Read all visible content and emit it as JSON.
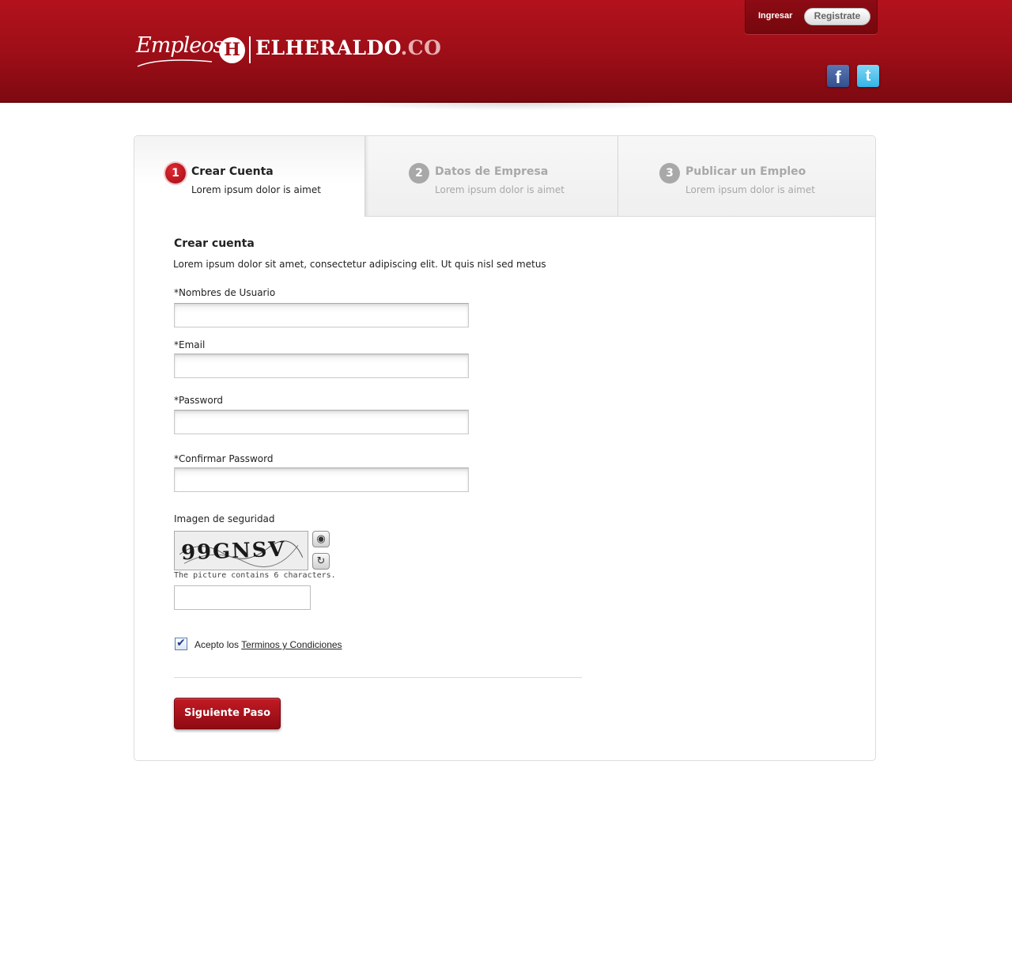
{
  "header": {
    "logo": {
      "script": "Empleos",
      "h_mark": "H",
      "wordmark": "ELHERALDO",
      "tld": ".CO"
    },
    "account": {
      "login_label": "Ingresar",
      "register_label": "Registrate"
    },
    "social": [
      {
        "name": "facebook",
        "glyph": "f"
      },
      {
        "name": "twitter",
        "glyph": "t"
      }
    ]
  },
  "steps": [
    {
      "number": "1",
      "title": "Crear Cuenta",
      "description": "Lorem ipsum dolor is aimet",
      "active": true
    },
    {
      "number": "2",
      "title": "Datos de Empresa",
      "description": "Lorem ipsum dolor is aimet",
      "active": false
    },
    {
      "number": "3",
      "title": "Publicar un Empleo",
      "description": "Lorem ipsum dolor is aimet",
      "active": false
    }
  ],
  "form": {
    "title": "Crear cuenta",
    "intro": "Lorem ipsum dolor sit amet, consectetur adipiscing elit. Ut quis nisl sed metus",
    "fields": {
      "username": {
        "label": "*Nombres de Usuario",
        "value": ""
      },
      "email": {
        "label": "*Email",
        "value": ""
      },
      "password": {
        "label": "*Password",
        "value": ""
      },
      "confirm_password": {
        "label": "*Confirmar Password",
        "value": ""
      }
    },
    "captcha": {
      "label": "Imagen de seguridad",
      "image_text": "99GNSV",
      "note": "The picture contains 6 characters.",
      "audio_icon": "speaker-icon",
      "refresh_icon": "refresh-icon",
      "value": ""
    },
    "terms": {
      "checked": true,
      "prefix": "Acepto los",
      "link_label": "Terminos y Condiciones"
    },
    "submit_label": "Siguiente Paso"
  },
  "colors": {
    "brand_red": "#a5101a",
    "muted_step": "#a8a8a8"
  }
}
